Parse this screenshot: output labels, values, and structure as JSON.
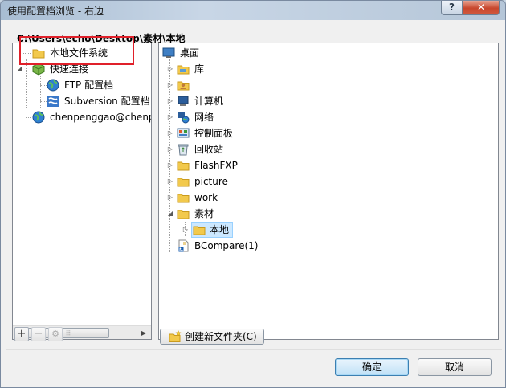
{
  "window": {
    "title": "使用配置档浏览 - 右边",
    "help_label": "?",
    "close_label": "✕"
  },
  "path": "C:\\Users\\echo\\Desktop\\素材\\本地",
  "left_tree": {
    "items": [
      {
        "label": "本地文件系统",
        "icon": "folder-icon"
      },
      {
        "label": "快速连接",
        "icon": "green-cube-icon"
      },
      {
        "label": "FTP 配置档",
        "icon": "globe-icon"
      },
      {
        "label": "Subversion 配置档",
        "icon": "subversion-icon"
      },
      {
        "label": "chenpenggao@chenp",
        "icon": "globe-icon"
      }
    ],
    "scroll_grip": "⦙⦙⦙"
  },
  "right_tree": {
    "items": [
      {
        "label": "桌面",
        "icon": "desktop-icon"
      },
      {
        "label": "库",
        "icon": "library-icon"
      },
      {
        "label": "",
        "icon": "user-folder-icon"
      },
      {
        "label": "计算机",
        "icon": "computer-icon"
      },
      {
        "label": "网络",
        "icon": "network-icon"
      },
      {
        "label": "控制面板",
        "icon": "control-panel-icon"
      },
      {
        "label": "回收站",
        "icon": "recycle-bin-icon"
      },
      {
        "label": "FlashFXP",
        "icon": "folder-icon"
      },
      {
        "label": "picture",
        "icon": "folder-icon"
      },
      {
        "label": "work",
        "icon": "folder-icon"
      },
      {
        "label": "素材",
        "icon": "folder-icon"
      },
      {
        "label": "本地",
        "icon": "folder-icon"
      },
      {
        "label": "BCompare(1)",
        "icon": "shortcut-icon"
      }
    ]
  },
  "toolbar": {
    "add_label": "+",
    "remove_label": "−",
    "settings_label": "⚙",
    "create_folder_label": "创建新文件夹(C)"
  },
  "buttons": {
    "ok_label": "确定",
    "cancel_label": "取消"
  },
  "colors": {
    "highlight_box": "#e0202a",
    "selection": "#cce8ff",
    "folder": "#f2c94c"
  }
}
